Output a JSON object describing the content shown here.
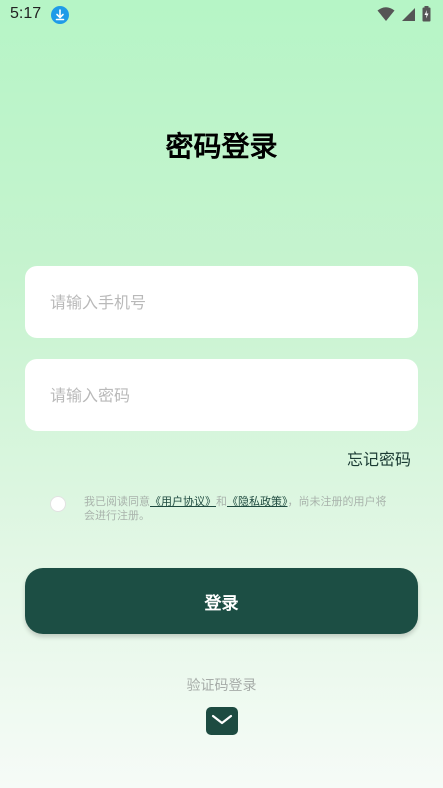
{
  "status_bar": {
    "time": "5:17",
    "icons": [
      "download-icon",
      "wifi-icon",
      "signal-icon",
      "battery-icon"
    ]
  },
  "page": {
    "title": "密码登录"
  },
  "form": {
    "phone_placeholder": "请输入手机号",
    "phone_value": "",
    "password_placeholder": "请输入密码",
    "password_value": "",
    "forgot_password": "忘记密码"
  },
  "agreement": {
    "checked": false,
    "prefix": "我已阅读同意",
    "user_agreement": "《用户协议》",
    "and": "和",
    "privacy_policy": "《隐私政策》",
    "suffix": "，尚未注册的用户将会进行注册。"
  },
  "actions": {
    "login_label": "登录",
    "code_login_label": "验证码登录",
    "code_login_icon": "mail-icon"
  },
  "colors": {
    "primary": "#1c4e44",
    "background_top": "#b6f5c6",
    "background_bottom": "#f6fbf7",
    "status_download": "#1e9be8"
  }
}
